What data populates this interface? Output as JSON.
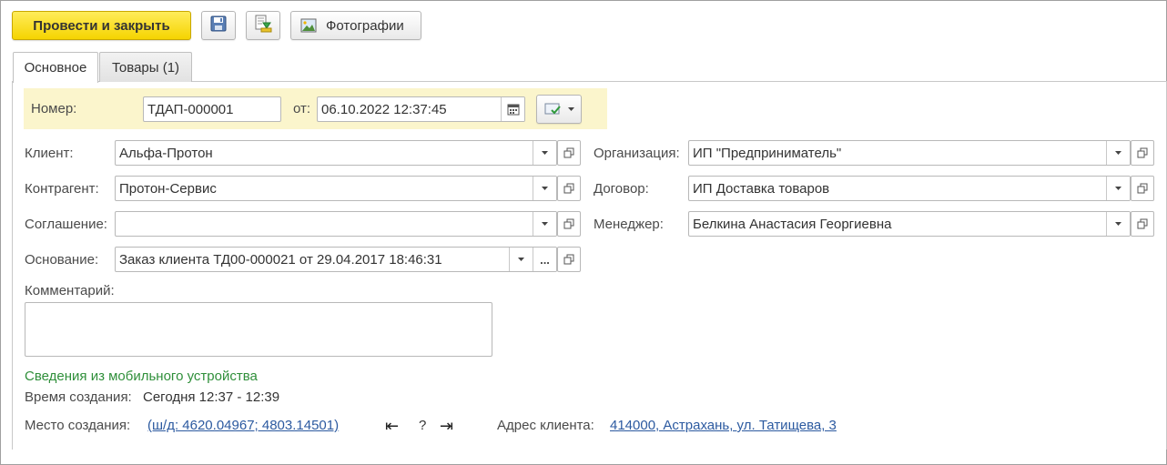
{
  "toolbar": {
    "post_and_close_label": "Провести и закрыть",
    "photos_label": "Фотографии"
  },
  "tabs": [
    {
      "label": "Основное",
      "active": true
    },
    {
      "label": "Товары (1)",
      "active": false
    }
  ],
  "header": {
    "number_label": "Номер:",
    "number_value": "ТДАП-000001",
    "date_label": "от:",
    "date_value": "06.10.2022 12:37:45"
  },
  "fields": {
    "client_label": "Клиент:",
    "client_value": "Альфа-Протон",
    "counterparty_label": "Контрагент:",
    "counterparty_value": "Протон-Сервис",
    "agreement_label": "Соглашение:",
    "agreement_value": "",
    "basis_label": "Основание:",
    "basis_value": "Заказ клиента ТД00-000021 от 29.04.2017 18:46:31",
    "organization_label": "Организация:",
    "organization_value": "ИП \"Предприниматель\"",
    "contract_label": "Договор:",
    "contract_value": "ИП Доставка товаров",
    "manager_label": "Менеджер:",
    "manager_value": "Белкина Анастасия Георгиевна",
    "comment_label": "Комментарий:",
    "comment_value": ""
  },
  "mobile": {
    "section_title": "Сведения из мобильного устройства",
    "created_time_label": "Время создания:",
    "created_time_value": "Сегодня 12:37 - 12:39",
    "created_place_label": "Место создания:",
    "created_place_value": "(ш/д: 4620.04967; 4803.14501)",
    "nav_prev": "⇤",
    "nav_unknown": "?",
    "nav_next": "⇥",
    "client_address_label": "Адрес клиента:",
    "client_address_value": "414000, Астрахань, ул. Татищева, 3"
  },
  "colors": {
    "primary_button": "#f5d400",
    "header_strip": "#fbf5cc",
    "section_title": "#2f8f3a",
    "link": "#2c5aa0"
  }
}
